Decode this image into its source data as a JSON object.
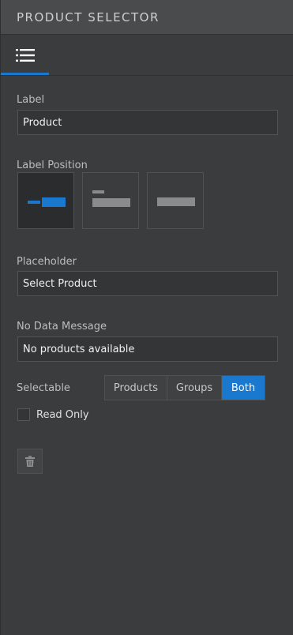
{
  "header": {
    "title": "PRODUCT SELECTOR"
  },
  "tabs": [
    {
      "icon": "list-icon",
      "active": true
    }
  ],
  "fields": {
    "label": {
      "caption": "Label",
      "value": "Product"
    },
    "label_position": {
      "caption": "Label Position",
      "options": [
        "inline",
        "top",
        "none"
      ],
      "selected": "inline"
    },
    "placeholder": {
      "caption": "Placeholder",
      "value": "Select Product"
    },
    "no_data_message": {
      "caption": "No Data Message",
      "value": "No products available"
    },
    "selectable": {
      "caption": "Selectable",
      "options": [
        "Products",
        "Groups",
        "Both"
      ],
      "selected": "Both"
    },
    "read_only": {
      "caption": "Read Only",
      "checked": false
    }
  },
  "actions": {
    "delete_icon": "trash-icon"
  },
  "colors": {
    "accent": "#1a78cf",
    "panel_bg": "#3b3c3e",
    "header_bg": "#4a4b4d"
  }
}
